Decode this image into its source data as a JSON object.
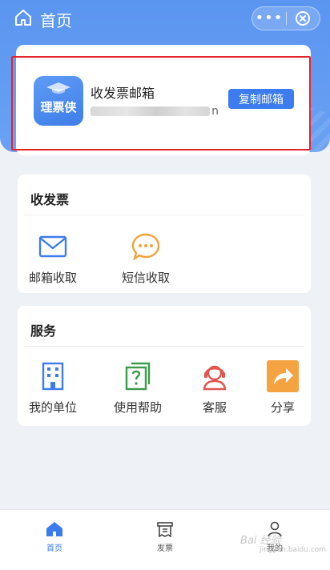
{
  "header": {
    "title": "首页",
    "more_label": "•••"
  },
  "email_card": {
    "logo_text": "理票侠",
    "title": "收发票邮箱",
    "address_visible_tail": "n",
    "copy_button": "复制邮箱"
  },
  "receive_section": {
    "title": "收发票",
    "items": [
      {
        "label": "邮箱收取",
        "icon": "envelope-icon"
      },
      {
        "label": "短信收取",
        "icon": "sms-bubble-icon"
      }
    ]
  },
  "service_section": {
    "title": "服务",
    "items": [
      {
        "label": "我的单位",
        "icon": "building-icon"
      },
      {
        "label": "使用帮助",
        "icon": "help-icon"
      },
      {
        "label": "客服",
        "icon": "support-agent-icon"
      },
      {
        "label": "分享",
        "icon": "share-arrow-icon"
      }
    ]
  },
  "tabbar": {
    "items": [
      {
        "label": "首页",
        "icon": "home-icon",
        "active": true
      },
      {
        "label": "发票",
        "icon": "invoice-icon",
        "active": false
      },
      {
        "label": "我的",
        "icon": "profile-icon",
        "active": false
      }
    ]
  },
  "watermark": {
    "text": "Bai 经验",
    "sub": "jingyan.baidu.com"
  },
  "colors": {
    "primary": "#3c7cef",
    "header_bg": "#5a95f0",
    "highlight_border": "#e5232a",
    "sms_icon": "#f0a33a",
    "help_icon": "#3a9b4a",
    "support_icon": "#e0564f",
    "share_icon_bg": "#f4a340"
  }
}
